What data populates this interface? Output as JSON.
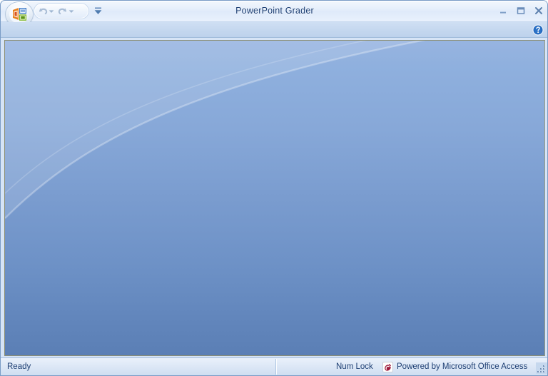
{
  "window": {
    "title": "PowerPoint Grader",
    "accent_color": "#1d3f73",
    "client_gradient_top": "#8fb0de",
    "client_gradient_bottom": "#5b7fb5"
  },
  "titlebar": {
    "office_button": "Office Button",
    "quick_access": {
      "undo_label": "Undo",
      "undo_dropdown_label": "Undo options",
      "redo_label": "Redo",
      "redo_dropdown_label": "Redo options",
      "customize_label": "Customize Quick Access Toolbar"
    },
    "controls": {
      "minimize_label": "Minimize",
      "maximize_label": "Maximize",
      "close_label": "Close"
    }
  },
  "ribbon": {
    "help_label": "Help"
  },
  "statusbar": {
    "ready_text": "Ready",
    "num_lock_text": "Num Lock",
    "powered_by_text": "Powered by Microsoft Office Access",
    "access_icon_color": "#9e1a3c",
    "resize_grip_label": "Resize"
  }
}
